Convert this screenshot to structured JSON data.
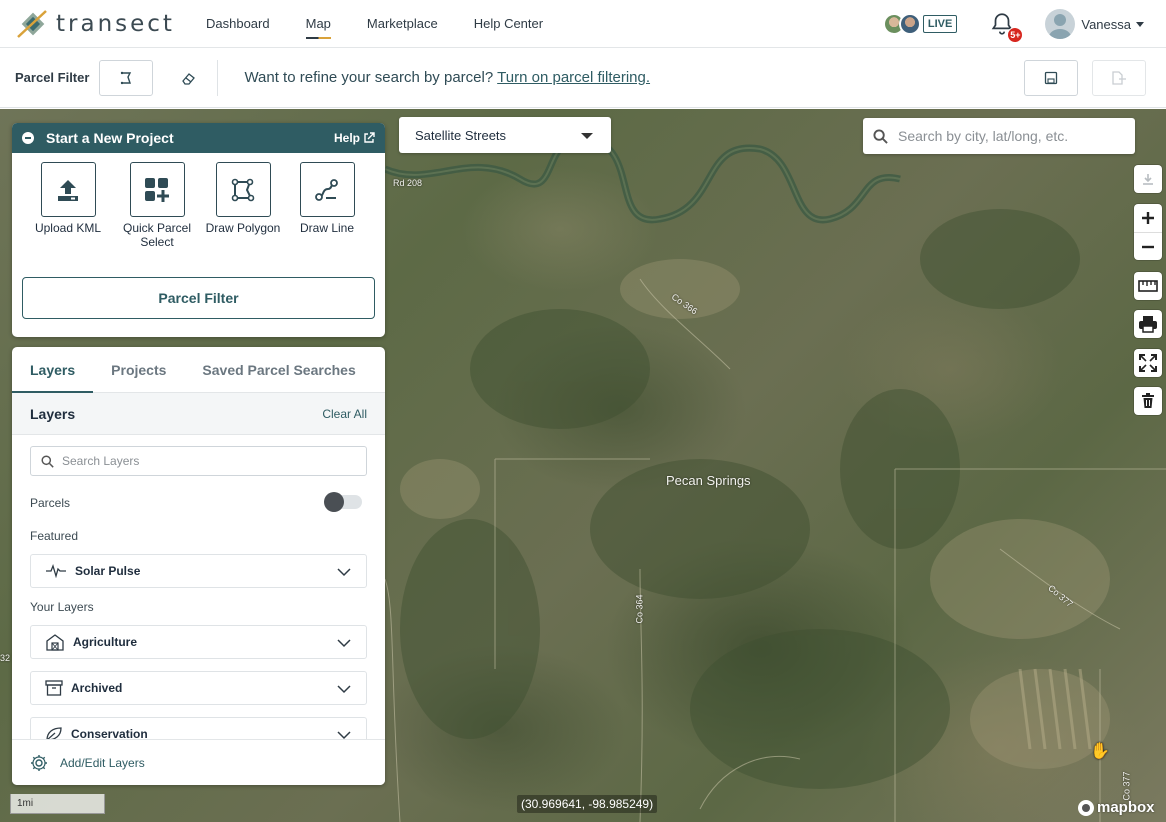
{
  "brand": {
    "name": "transect"
  },
  "nav": {
    "links": [
      {
        "label": "Dashboard"
      },
      {
        "label": "Map"
      },
      {
        "label": "Marketplace"
      },
      {
        "label": "Help Center"
      }
    ],
    "live_label": "LIVE",
    "notification_count": "5+",
    "user_name": "Vanessa"
  },
  "filterbar": {
    "label": "Parcel Filter",
    "message": "Want to refine your search by parcel?",
    "link": "Turn on parcel filtering."
  },
  "map": {
    "style_select": "Satellite Streets",
    "search_placeholder": "Search by city, lat/long, etc.",
    "place_label": "Pecan Springs",
    "road_labels": [
      "Rd 208",
      "Co 366",
      "Co 364",
      "Co 377",
      "Co 377",
      "32"
    ],
    "coordinates": "(30.969641, -98.985249)",
    "scale_label": "1mi",
    "attribution": "mapbox"
  },
  "project_panel": {
    "title": "Start a New Project",
    "help": "Help",
    "tools": [
      {
        "label": "Upload KML"
      },
      {
        "label": "Quick Parcel Select"
      },
      {
        "label": "Draw Polygon"
      },
      {
        "label": "Draw Line"
      }
    ],
    "parcel_filter_button": "Parcel Filter"
  },
  "layers_panel": {
    "tabs": [
      {
        "label": "Layers"
      },
      {
        "label": "Projects"
      },
      {
        "label": "Saved Parcel Searches"
      }
    ],
    "subheader": "Layers",
    "clear_all": "Clear All",
    "search_placeholder": "Search Layers",
    "parcels_label": "Parcels",
    "parcels_enabled": false,
    "featured_label": "Featured",
    "featured": [
      {
        "label": "Solar Pulse"
      }
    ],
    "your_layers_label": "Your Layers",
    "your_layers": [
      {
        "label": "Agriculture"
      },
      {
        "label": "Archived"
      },
      {
        "label": "Conservation"
      }
    ],
    "footer": "Add/Edit Layers"
  },
  "colors": {
    "brand_teal": "#2f5c63",
    "notification_red": "#d7261e",
    "accent_gold": "#d9a23a"
  }
}
